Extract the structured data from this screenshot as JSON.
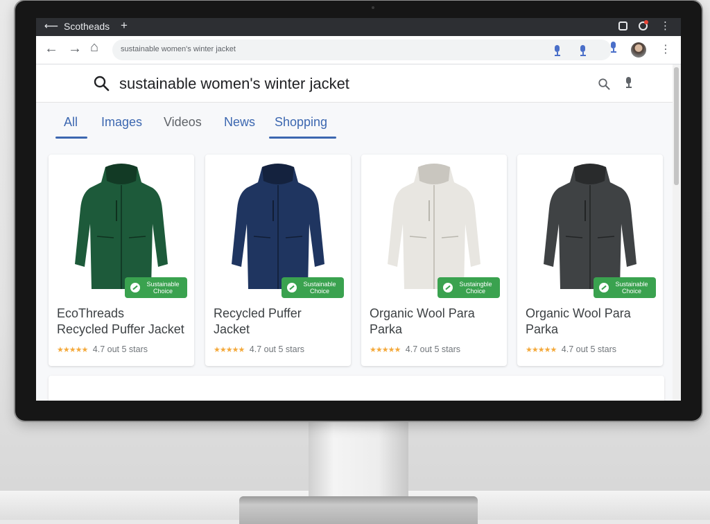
{
  "browser": {
    "tab_title": "Scotheads",
    "tab_new_symbol": "+",
    "url": "sustainable women's winter jacket"
  },
  "search": {
    "query": "sustainable women's winter jacket",
    "tabs": [
      {
        "label": "All",
        "active": true
      },
      {
        "label": "Images",
        "active": false
      },
      {
        "label": "Videos",
        "active": false
      },
      {
        "label": "News",
        "active": false
      },
      {
        "label": "Shopping",
        "active": true
      }
    ]
  },
  "products": [
    {
      "title_line1": "EcoThreads",
      "title_line2": "Recycled Puffer Jacket",
      "badge_line1": "Sustainable",
      "badge_line2": "Choice",
      "stars": "★★★★★",
      "rating_value": 4.7,
      "rating_text": "4.7 out 5 stars",
      "color": "#1d5a3a"
    },
    {
      "title_line1": "Recycled Puffer",
      "title_line2": "Jacket",
      "badge_line1": "Sustainable",
      "badge_line2": "Choice",
      "stars": "★★★★★",
      "rating_value": 4.7,
      "rating_text": "4.7 out 5 stars",
      "color": "#1f3560"
    },
    {
      "title_line1": "Organic Wool Para",
      "title_line2": "Parka",
      "badge_line1": "Sustaingble",
      "badge_line2": "Choice",
      "stars": "★★★★★",
      "rating_value": 4.7,
      "rating_text": "4.7 out 5 stars",
      "color": "#e8e6e1"
    },
    {
      "title_line1": "Organic Wool Para",
      "title_line2": "Parka",
      "badge_line1": "Sustainable",
      "badge_line2": "Choice",
      "stars": "★★★★★",
      "rating_value": 4.7,
      "rating_text": "4.7 out 5 stars",
      "color": "#3f4244"
    }
  ],
  "colors": {
    "accent": "#3c67b0",
    "badge": "#3aa24f",
    "star": "#f4a93b"
  },
  "icons": [
    "back-arrow-icon",
    "forward-arrow-icon",
    "home-icon",
    "mic-icon",
    "search-icon",
    "more-icon",
    "leaf-icon"
  ]
}
